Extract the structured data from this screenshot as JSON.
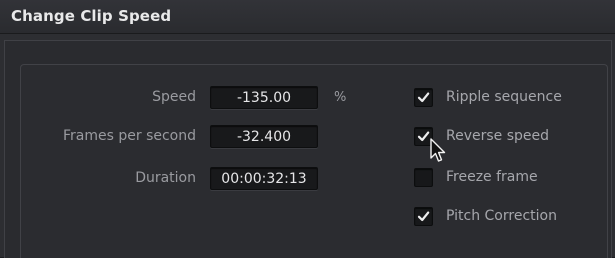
{
  "dialog": {
    "title": "Change Clip Speed"
  },
  "fields": {
    "speed": {
      "label": "Speed",
      "value": "-135.00",
      "unit": "%"
    },
    "fps": {
      "label": "Frames per second",
      "value": "-32.400"
    },
    "duration": {
      "label": "Duration",
      "value": "00:00:32:13"
    }
  },
  "options": {
    "ripple_sequence": {
      "label": "Ripple sequence",
      "checked": true
    },
    "reverse_speed": {
      "label": "Reverse speed",
      "checked": true
    },
    "freeze_frame": {
      "label": "Freeze frame",
      "checked": false
    },
    "pitch_correction": {
      "label": "Pitch Correction",
      "checked": true
    }
  },
  "icons": {
    "checkmark": "check-icon",
    "cursor": "mouse-pointer-icon"
  },
  "colors": {
    "background": "#2d2e32",
    "field": "#18191b",
    "text": "#e6e6e8",
    "label": "#9a9ba0"
  }
}
